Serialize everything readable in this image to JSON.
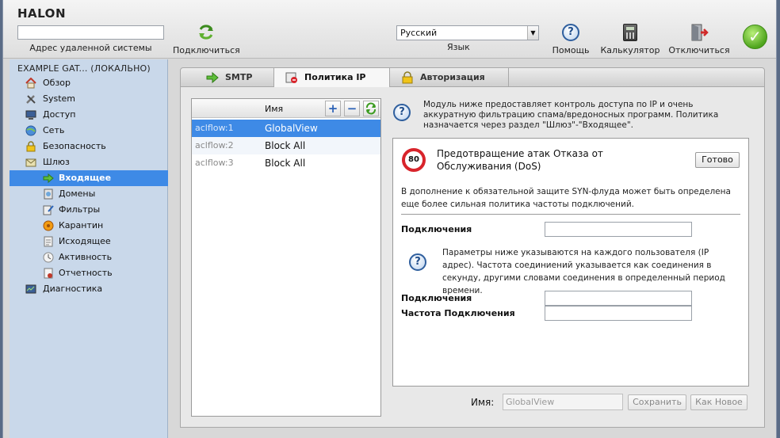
{
  "header": {
    "logo": "HALON",
    "address_label": "Адрес удаленной системы",
    "address_value": "",
    "connect_label": "Подключиться",
    "language_value": "Русский",
    "language_label": "Язык",
    "help_label": "Помощь",
    "calculator_label": "Калькулятор",
    "disconnect_label": "Отключиться"
  },
  "sidebar": {
    "title": "EXAMPLE GAT... (ЛОКАЛЬНО)",
    "items": [
      {
        "label": "Обзор",
        "icon": "home-icon"
      },
      {
        "label": "System",
        "icon": "tools-icon"
      },
      {
        "label": "Доступ",
        "icon": "monitor-icon"
      },
      {
        "label": "Сеть",
        "icon": "globe-icon"
      },
      {
        "label": "Безопасность",
        "icon": "lock-icon"
      },
      {
        "label": "Шлюз",
        "icon": "gateway-icon"
      },
      {
        "label": "Входящее",
        "icon": "arrow-right-icon"
      },
      {
        "label": "Домены",
        "icon": "domains-icon"
      },
      {
        "label": "Фильтры",
        "icon": "filters-icon"
      },
      {
        "label": "Карантин",
        "icon": "biohazard-icon"
      },
      {
        "label": "Исходящее",
        "icon": "outgoing-icon"
      },
      {
        "label": "Активность",
        "icon": "activity-icon"
      },
      {
        "label": "Отчетность",
        "icon": "report-icon"
      },
      {
        "label": "Диагностика",
        "icon": "diagnostics-icon"
      }
    ]
  },
  "tabs": [
    {
      "label": "SMTP",
      "icon": "arrow-right-icon"
    },
    {
      "label": "Политика IP",
      "icon": "policy-icon"
    },
    {
      "label": "Авторизация",
      "icon": "lock-icon"
    }
  ],
  "list": {
    "column_name": "Имя",
    "rows": [
      {
        "id": "aclflow:1",
        "name": "GlobalView"
      },
      {
        "id": "aclflow:2",
        "name": "Block All"
      },
      {
        "id": "aclflow:3",
        "name": "Block All"
      }
    ]
  },
  "description": "Модуль ниже предоставляет контроль доступа по IP и очень аккуратную фильтрацию спама/вредоносных программ. Политика назначается через раздел \"Шлюз\"-\"Входящее\".",
  "panel": {
    "badge": "80",
    "title": "Предотвращение атак Отказа от Обслуживания (DoS)",
    "done_label": "Готово",
    "intro": "В дополнение к обязательной защите SYN-флуда может быть определена еще более сильная политика частоты подключений.",
    "connections_label": "Подключения",
    "per_user_desc": "Параметры ниже указываются на каждого пользователя (IP адрес). Частота соединиений указывается как соединения в секунду, другими словами соединения в определенный период времени.",
    "connections2_label": "Подключения",
    "rate_label": "Частота Подключения"
  },
  "footer": {
    "name_label": "Имя:",
    "name_value": "GlobalView",
    "save_label": "Сохранить",
    "save_new_label": "Как Новое"
  }
}
